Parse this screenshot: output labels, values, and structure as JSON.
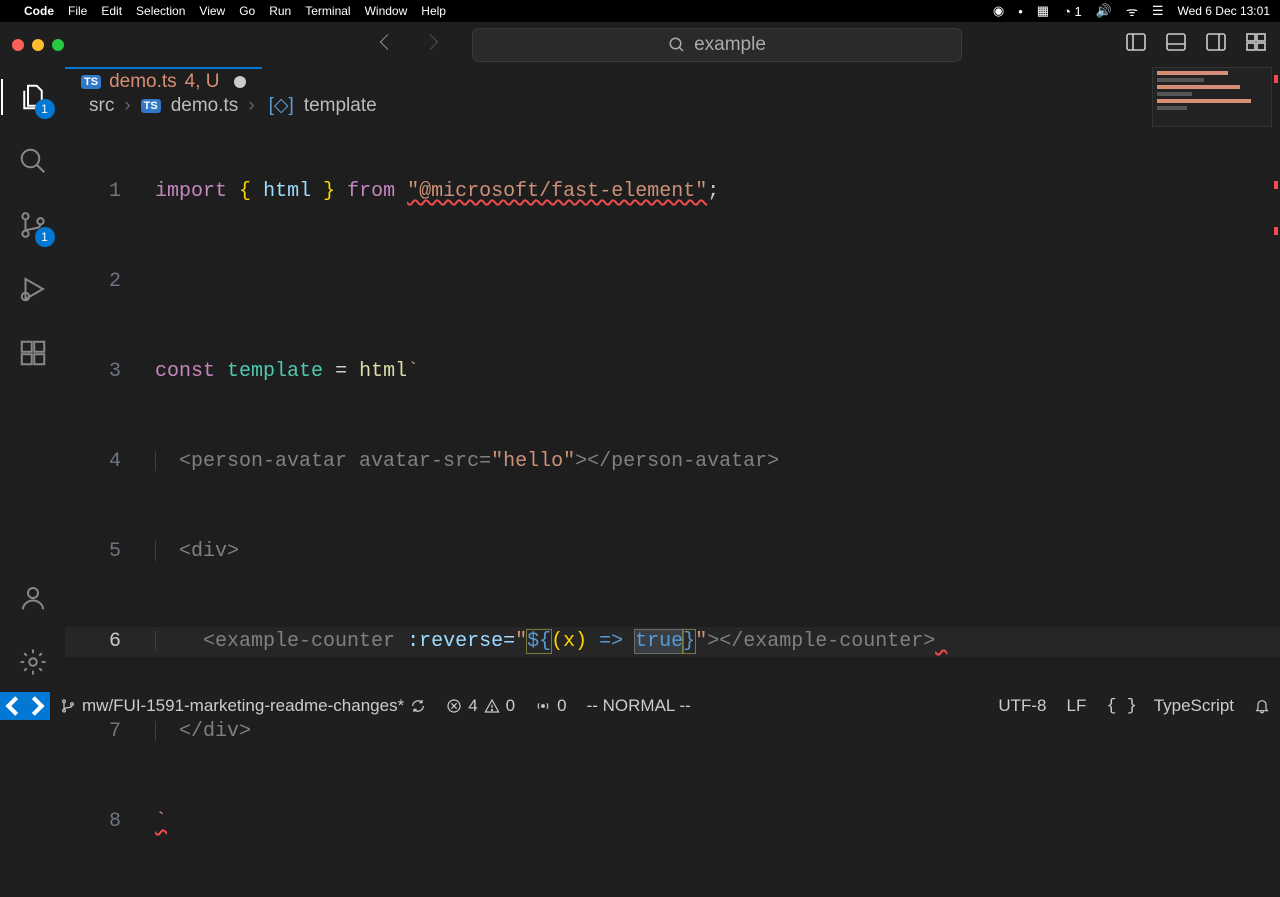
{
  "menubar": {
    "app": "Code",
    "items": [
      "File",
      "Edit",
      "Selection",
      "View",
      "Go",
      "Run",
      "Terminal",
      "Window",
      "Help"
    ],
    "clock": "Wed 6 Dec  13:01"
  },
  "titlebar": {
    "search_text": "example"
  },
  "activity": {
    "explorer_badge": "1",
    "scm_badge": "1"
  },
  "tab": {
    "ts_label": "TS",
    "filename": "demo.ts",
    "status": "4, U"
  },
  "breadcrumb": {
    "folder": "src",
    "ts_label": "TS",
    "file": "demo.ts",
    "symbol": "template"
  },
  "code": {
    "lines": [
      "1",
      "2",
      "3",
      "4",
      "5",
      "6",
      "7",
      "8"
    ],
    "l1": {
      "kw1": "import",
      "brace_o": "{",
      "id": "html",
      "brace_c": "}",
      "kw2": "from",
      "str": "\"@microsoft/fast-element\"",
      "semi": ";"
    },
    "l3": {
      "kw": "const",
      "id": "template",
      "eq": "=",
      "fn": "html",
      "tick": "`"
    },
    "l4": {
      "text": "<person-avatar avatar-src=",
      "val": "\"hello\"",
      "rest": "></person-avatar>"
    },
    "l5": {
      "text": "<div>"
    },
    "l6": {
      "open": "<example-counter ",
      "attr": ":reverse=",
      "q": "\"",
      "dol": "${",
      "px": "(x)",
      "arrow": " => ",
      "tru": "true",
      "cb": "}",
      "q2": "\"",
      "close": "></example-counter>"
    },
    "l7": {
      "text": "</div>"
    },
    "l8": {
      "tick": "`"
    }
  },
  "statusbar": {
    "branch": "mw/FUI-1591-marketing-readme-changes*",
    "errors": "4",
    "warnings": "0",
    "port": "0",
    "mode": "-- NORMAL --",
    "encoding": "UTF-8",
    "eol": "LF",
    "lang": "TypeScript"
  }
}
